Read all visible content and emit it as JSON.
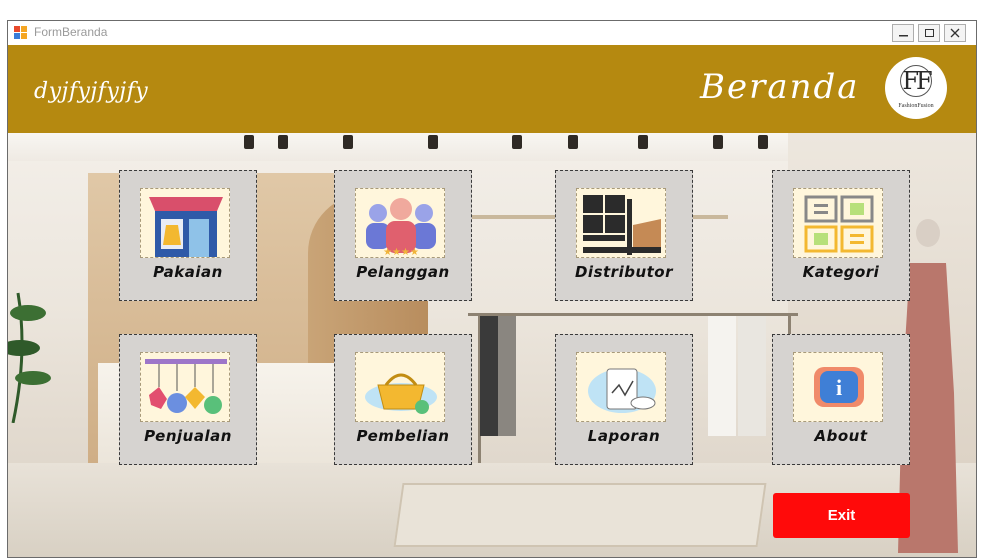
{
  "window": {
    "title": "FormBeranda"
  },
  "header": {
    "subtitle": "dyjfyjfyjfy",
    "title": "Beranda",
    "logo_text": "FashionFusion",
    "logo_mark": "FF"
  },
  "menu": [
    {
      "label": "Pakaian",
      "icon": "clothing-store-icon"
    },
    {
      "label": "Pelanggan",
      "icon": "customers-icon"
    },
    {
      "label": "Distributor",
      "icon": "forklift-boxes-icon"
    },
    {
      "label": "Kategori",
      "icon": "category-grid-icon"
    },
    {
      "label": "Penjualan",
      "icon": "sale-tags-icon"
    },
    {
      "label": "Pembelian",
      "icon": "shopping-basket-icon"
    },
    {
      "label": "Laporan",
      "icon": "report-chart-icon"
    },
    {
      "label": "About",
      "icon": "info-icon"
    }
  ],
  "exit_label": "Exit",
  "colors": {
    "header": "#b58910",
    "exit": "#ff0a0a",
    "tile": "#d6d3d0"
  }
}
